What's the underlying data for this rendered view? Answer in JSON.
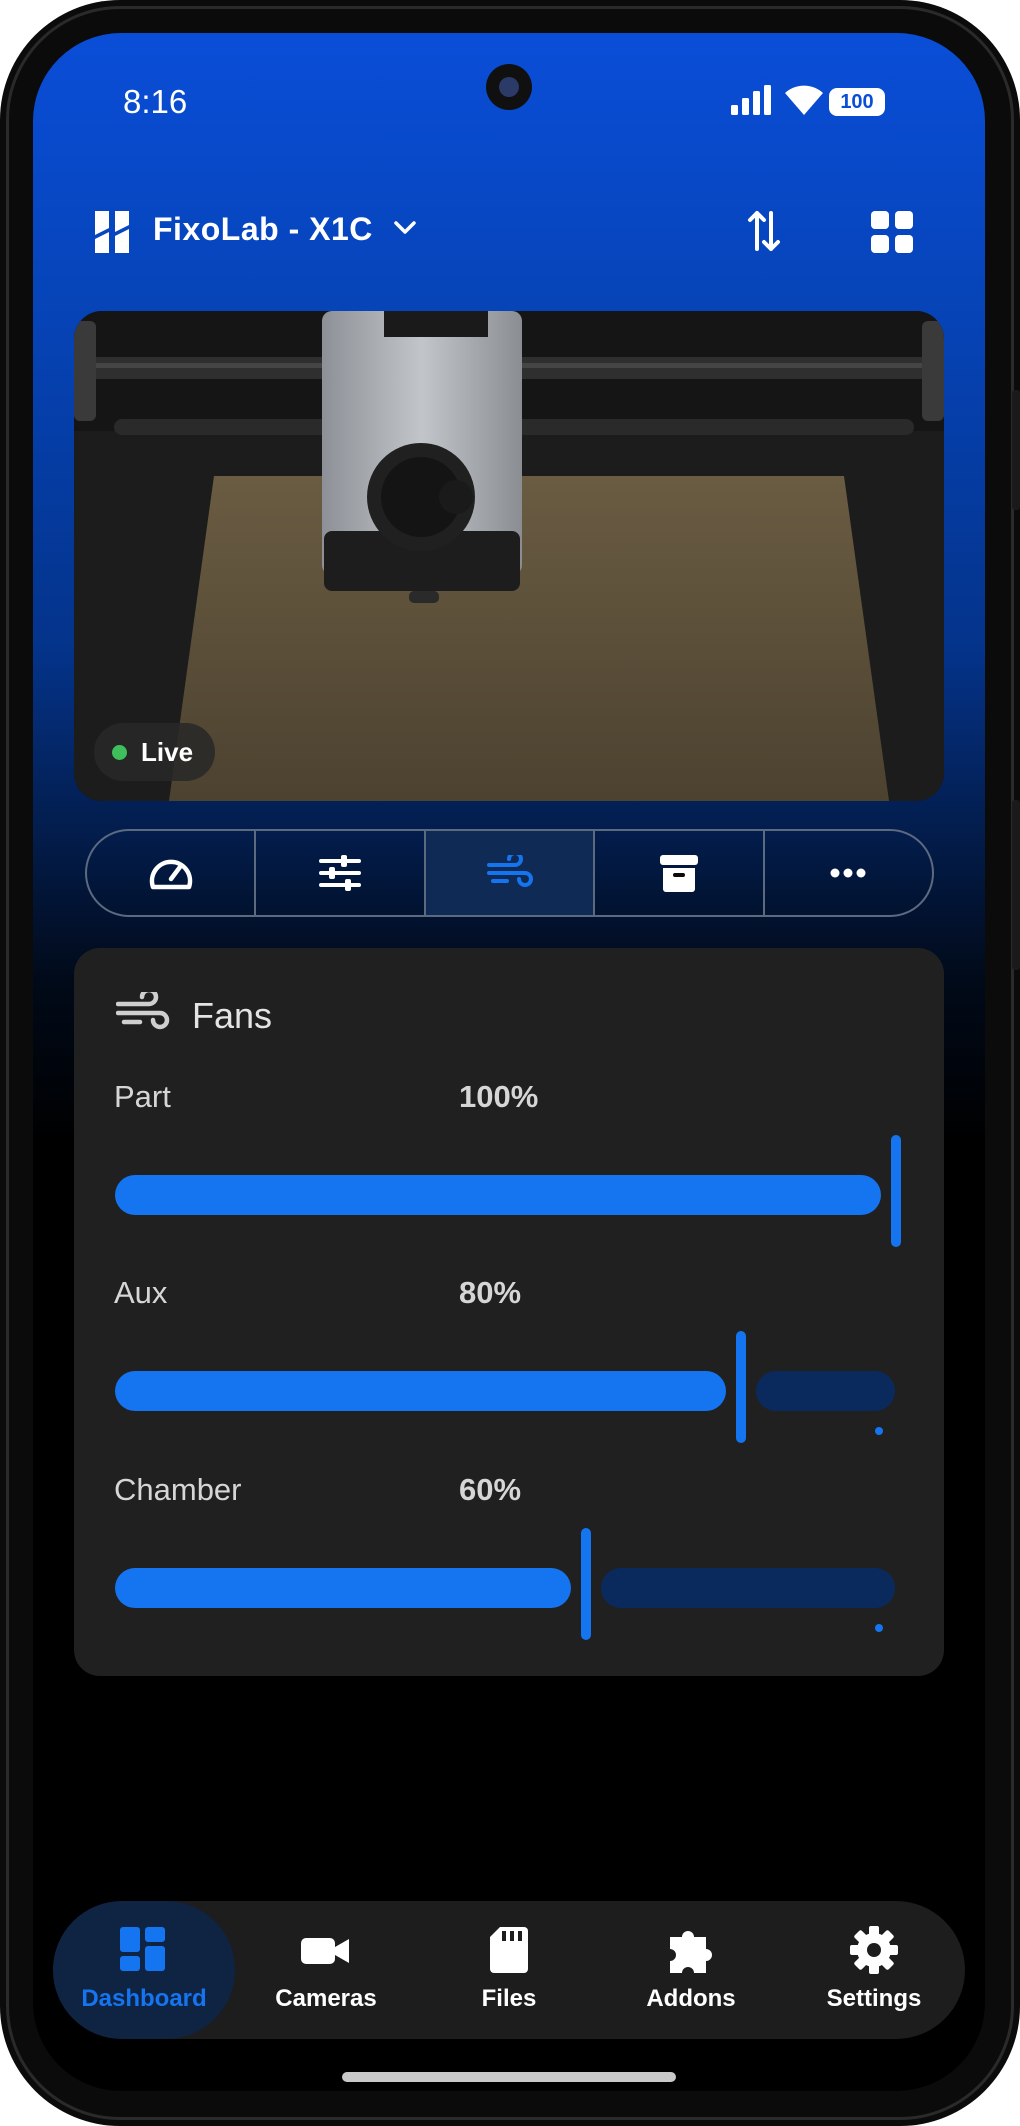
{
  "status_bar": {
    "time": "8:16",
    "battery": "100"
  },
  "header": {
    "printer_name": "FixoLab - X1C"
  },
  "camera": {
    "live_label": "Live",
    "live_color": "#3fbf5c"
  },
  "control_tabs": [
    {
      "icon": "gauge-icon",
      "active": false
    },
    {
      "icon": "sliders-icon",
      "active": false
    },
    {
      "icon": "wind-icon",
      "active": true
    },
    {
      "icon": "archive-icon",
      "active": false
    },
    {
      "icon": "more-horizontal-icon",
      "active": false
    }
  ],
  "fans_card": {
    "title": "Fans",
    "fans": [
      {
        "label": "Part",
        "value": "100%",
        "level": 1.0
      },
      {
        "label": "Aux",
        "value": "80%",
        "level": 0.8
      },
      {
        "label": "Chamber",
        "value": "60%",
        "level": 0.6
      }
    ]
  },
  "bottom_nav": [
    {
      "label": "Dashboard",
      "icon": "dashboard-icon",
      "active": true
    },
    {
      "label": "Cameras",
      "icon": "video-camera-icon",
      "active": false
    },
    {
      "label": "Files",
      "icon": "sd-card-icon",
      "active": false
    },
    {
      "label": "Addons",
      "icon": "puzzle-icon",
      "active": false
    },
    {
      "label": "Settings",
      "icon": "gear-icon",
      "active": false
    }
  ],
  "colors": {
    "accent": "#1574f0",
    "accent_track": "#0a2a5e",
    "card_bg": "#202020",
    "header_blue": "#0a4ed8"
  }
}
